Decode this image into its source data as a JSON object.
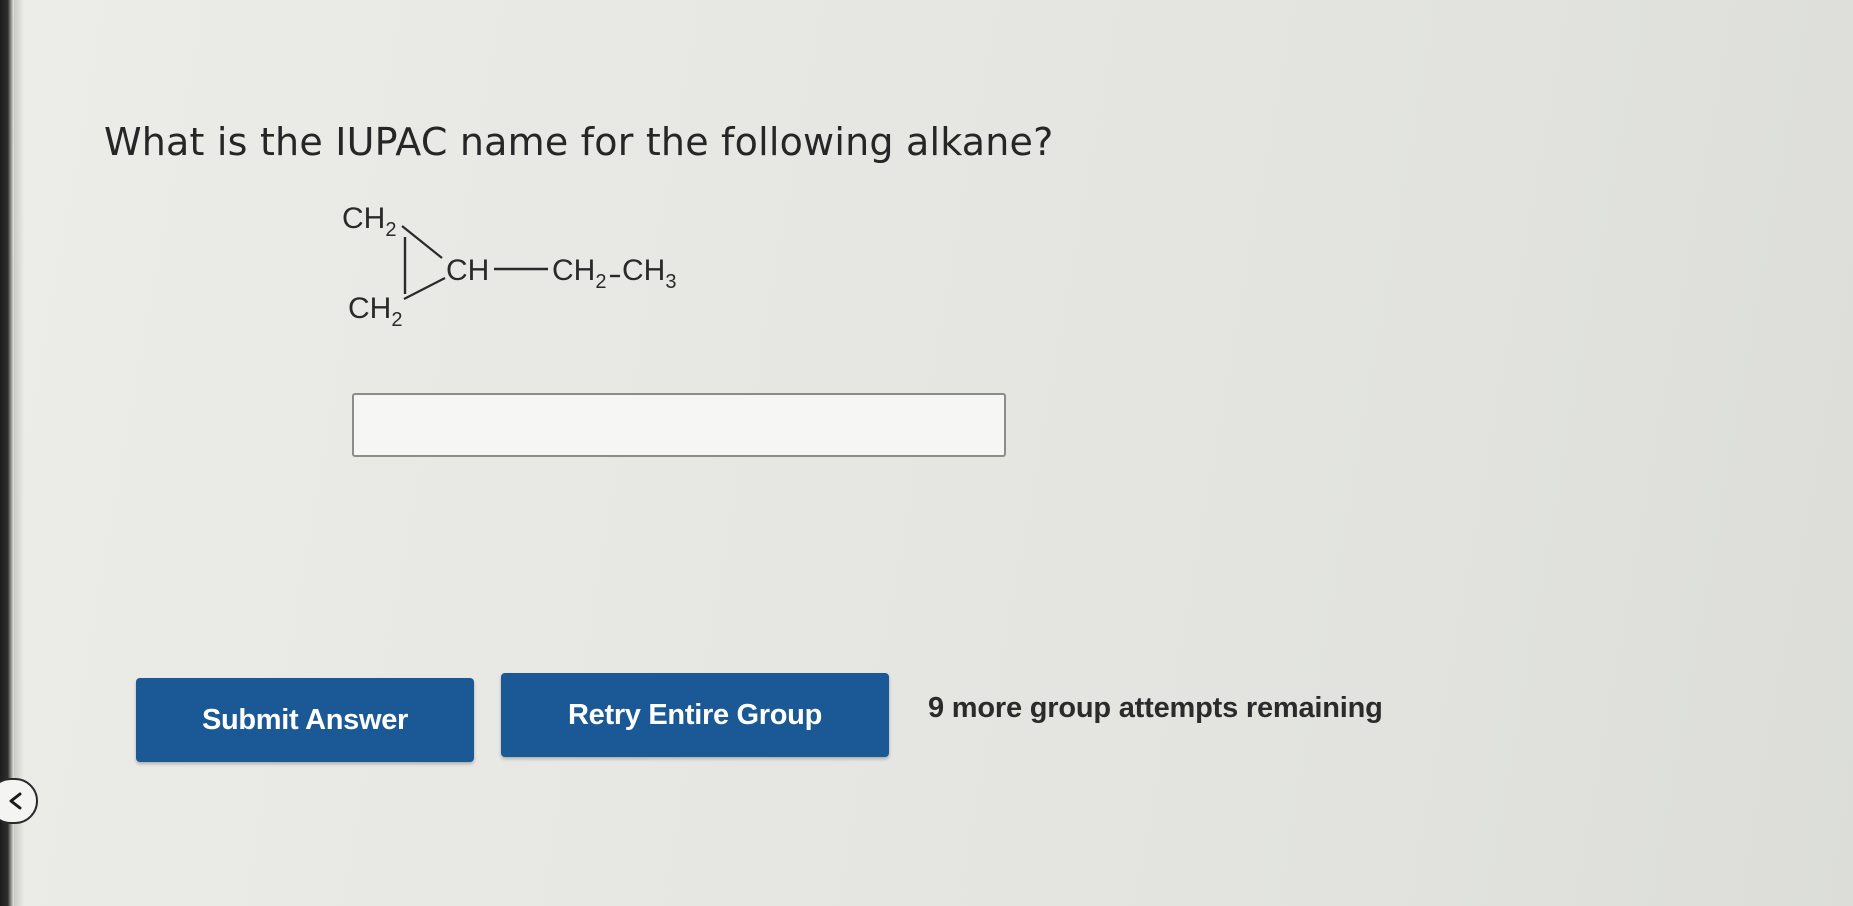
{
  "question": {
    "text": "What is the IUPAC name for the following alkane?"
  },
  "molecule": {
    "top_group": "CH",
    "top_sub": "2",
    "bottom_group": "CH",
    "bottom_sub": "2",
    "ring_ch": "CH",
    "ethyl_ch2": "CH",
    "ethyl_ch2_sub": "2",
    "ethyl_ch3": "CH",
    "ethyl_ch3_sub": "3"
  },
  "answer": {
    "value": "",
    "placeholder": ""
  },
  "buttons": {
    "submit_label": "Submit Answer",
    "retry_label": "Retry Entire Group"
  },
  "status": {
    "attempts_text": "9 more group attempts remaining"
  },
  "colors": {
    "button_bg": "#1b5896",
    "button_text": "#ffffff",
    "background": "#e8e8e4"
  },
  "icons": {
    "back": "chevron-left-icon"
  }
}
